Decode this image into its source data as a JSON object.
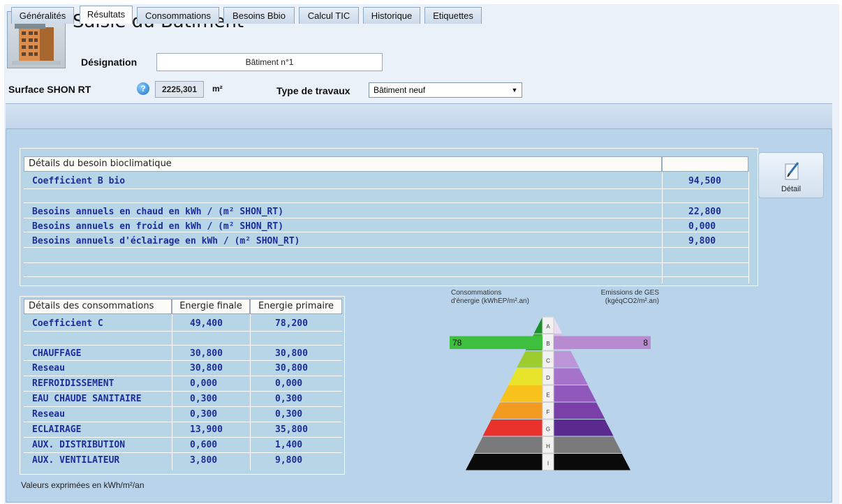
{
  "header": {
    "title": "Saisie du Bâtiment",
    "designation_label": "Désignation",
    "designation_value": "Bâtiment n°1",
    "surface_label": "Surface SHON RT",
    "surface_value": "2225,301",
    "surface_unit": "m²",
    "help_icon_glyph": "?",
    "type_label": "Type de travaux",
    "type_value": "Bâtiment neuf",
    "dropdown_arrow": "▼"
  },
  "tabs": [
    {
      "label": "Généralités"
    },
    {
      "label": "Résultats",
      "active": true
    },
    {
      "label": "Consommations"
    },
    {
      "label": "Besoins Bbio"
    },
    {
      "label": "Calcul TIC"
    },
    {
      "label": "Historique"
    },
    {
      "label": "Etiquettes"
    }
  ],
  "bbio": {
    "header": "Détails du besoin bioclimatique",
    "rows": [
      {
        "label": "Coefficient B bio",
        "value": "94,500"
      },
      {
        "label": "Besoins annuels en chaud en kWh / (m² SHON_RT)",
        "value": "22,800"
      },
      {
        "label": "Besoins annuels en froid en kWh / (m² SHON_RT)",
        "value": "0,000"
      },
      {
        "label": "Besoins annuels d'éclairage en kWh / (m² SHON_RT)",
        "value": "9,800"
      }
    ]
  },
  "detail_button": {
    "label": "Détail",
    "icon": "pen-paper-icon"
  },
  "conso": {
    "headers": [
      "Détails des consommations",
      "Energie finale",
      "Energie primaire"
    ],
    "rows": [
      {
        "label": "Coefficient C",
        "finale": "49,400",
        "primaire": "78,200"
      },
      {
        "label": "CHAUFFAGE",
        "finale": "30,800",
        "primaire": "30,800"
      },
      {
        "label": " Reseau",
        "finale": "30,800",
        "primaire": "30,800"
      },
      {
        "label": "REFROIDISSEMENT",
        "finale": "0,000",
        "primaire": "0,000"
      },
      {
        "label": "EAU CHAUDE SANITAIRE",
        "finale": "0,300",
        "primaire": "0,300"
      },
      {
        "label": " Reseau",
        "finale": "0,300",
        "primaire": "0,300"
      },
      {
        "label": "ECLAIRAGE",
        "finale": "13,900",
        "primaire": "35,800"
      },
      {
        "label": "AUX. DISTRIBUTION",
        "finale": "0,600",
        "primaire": "1,400"
      },
      {
        "label": "AUX. VENTILATEUR",
        "finale": "3,800",
        "primaire": "9,800"
      }
    ]
  },
  "footer": "Valeurs exprimées en kWh/m²/an",
  "energy": {
    "left_title_1": "Consommations",
    "left_title_2": "d'énergie (kWhEP/m².an)",
    "right_title_1": "Emissions de GES",
    "right_title_2": "(kgéqCO2/m².an)",
    "classes": [
      "A",
      "B",
      "C",
      "D",
      "E",
      "F",
      "G",
      "H",
      "I"
    ],
    "left_colors": [
      "#1a8f2a",
      "#3fae2b",
      "#9ccc2e",
      "#e7e32a",
      "#f7c21c",
      "#f39b21",
      "#e8322b",
      "#7a7a7a",
      "#0a0a0a"
    ],
    "right_colors": [
      "#eadbf0",
      "#d6b9e6",
      "#bc94d8",
      "#a573ca",
      "#9158bb",
      "#7a3fa8",
      "#5b2a8f",
      "#7a7a7a",
      "#0a0a0a"
    ],
    "conso_value": "78",
    "conso_class": "B",
    "ges_value": "8",
    "ges_class": "B",
    "conso_marker_color": "#3fbf3f",
    "ges_marker_color": "#b88ad0"
  }
}
